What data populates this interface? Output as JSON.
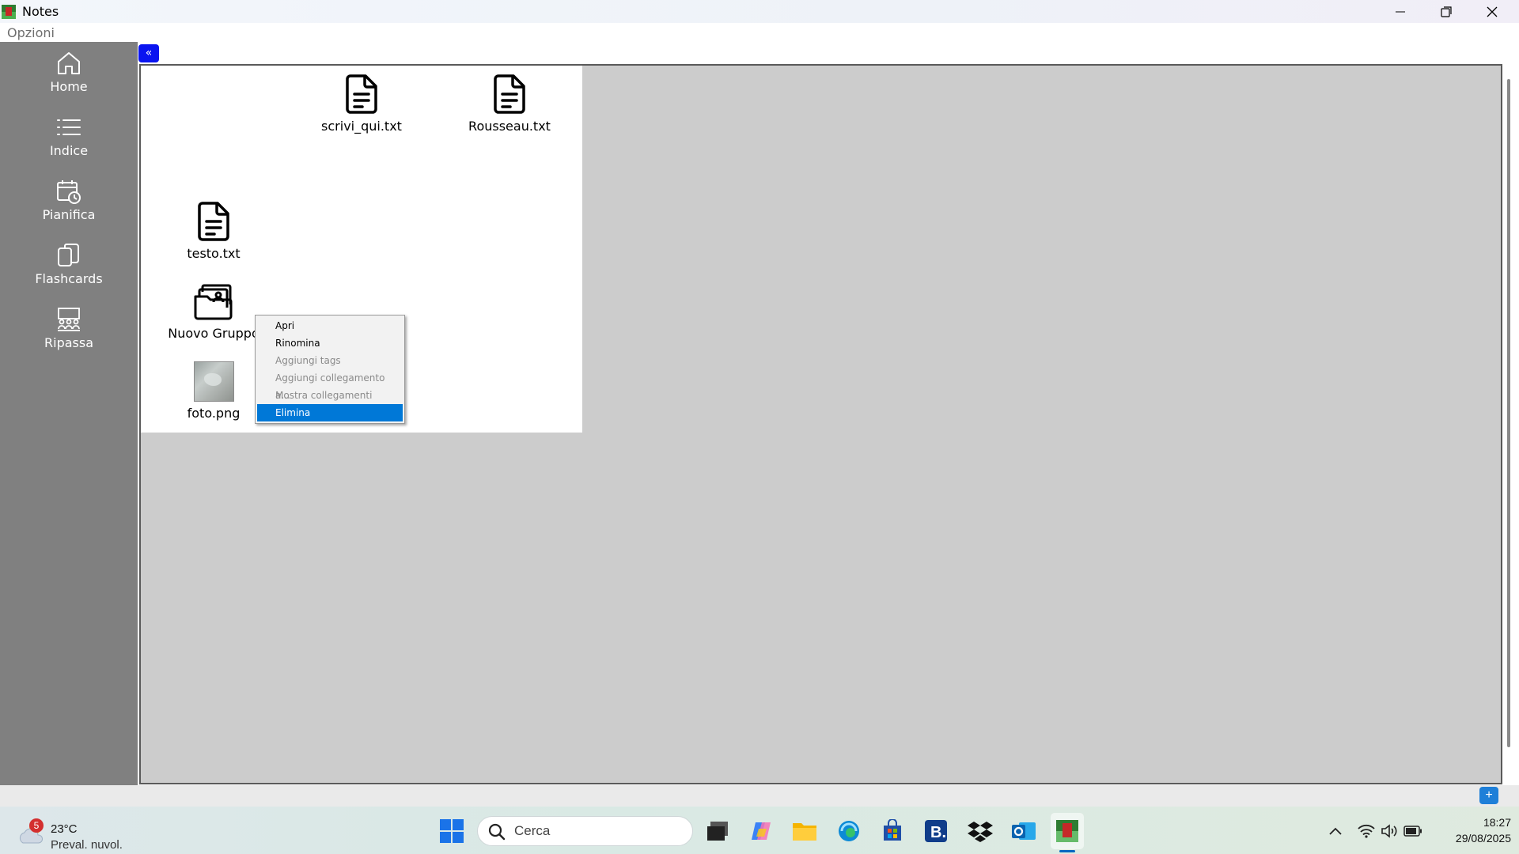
{
  "window": {
    "title": "Notes",
    "menu": [
      "Opzioni"
    ]
  },
  "sidebar": {
    "items": [
      {
        "label": "Home",
        "icon": "home-icon"
      },
      {
        "label": "Indice",
        "icon": "list-icon"
      },
      {
        "label": "Pianifica",
        "icon": "calendar-clock-icon"
      },
      {
        "label": "Flashcards",
        "icon": "cards-icon"
      },
      {
        "label": "Ripassa",
        "icon": "classroom-icon"
      }
    ]
  },
  "collapse_button": {
    "label": "«"
  },
  "files": [
    {
      "name": "scrivi_qui.txt",
      "icon": "document-icon"
    },
    {
      "name": "Rousseau.txt",
      "icon": "document-icon"
    },
    {
      "name": "testo.txt",
      "icon": "document-icon"
    },
    {
      "name": "Nuovo Gruppo",
      "icon": "folder-group-icon"
    },
    {
      "name": "foto.png",
      "icon": "image-thumbnail"
    }
  ],
  "context_menu": {
    "items": [
      {
        "label": "Apri",
        "enabled": true,
        "selected": false
      },
      {
        "label": "Rinomina",
        "enabled": true,
        "selected": false
      },
      {
        "label": "Aggiungi tags",
        "enabled": false,
        "selected": false
      },
      {
        "label": "Aggiungi collegamento a...",
        "enabled": false,
        "selected": false
      },
      {
        "label": "Mostra collegamenti",
        "enabled": false,
        "selected": false
      },
      {
        "label": "Elimina",
        "enabled": true,
        "selected": true
      }
    ]
  },
  "add_button": {
    "label": "+"
  },
  "taskbar": {
    "weather": {
      "badge": "5",
      "temp": "23°C",
      "desc": "Preval. nuvol."
    },
    "search_placeholder": "Cerca",
    "clock": {
      "time": "18:27",
      "date": "29/08/2025"
    }
  },
  "colors": {
    "sidebar": "#808080",
    "accent": "#0078d7",
    "collapse_button": "#0a14f0",
    "canvas": "#cccccc"
  }
}
